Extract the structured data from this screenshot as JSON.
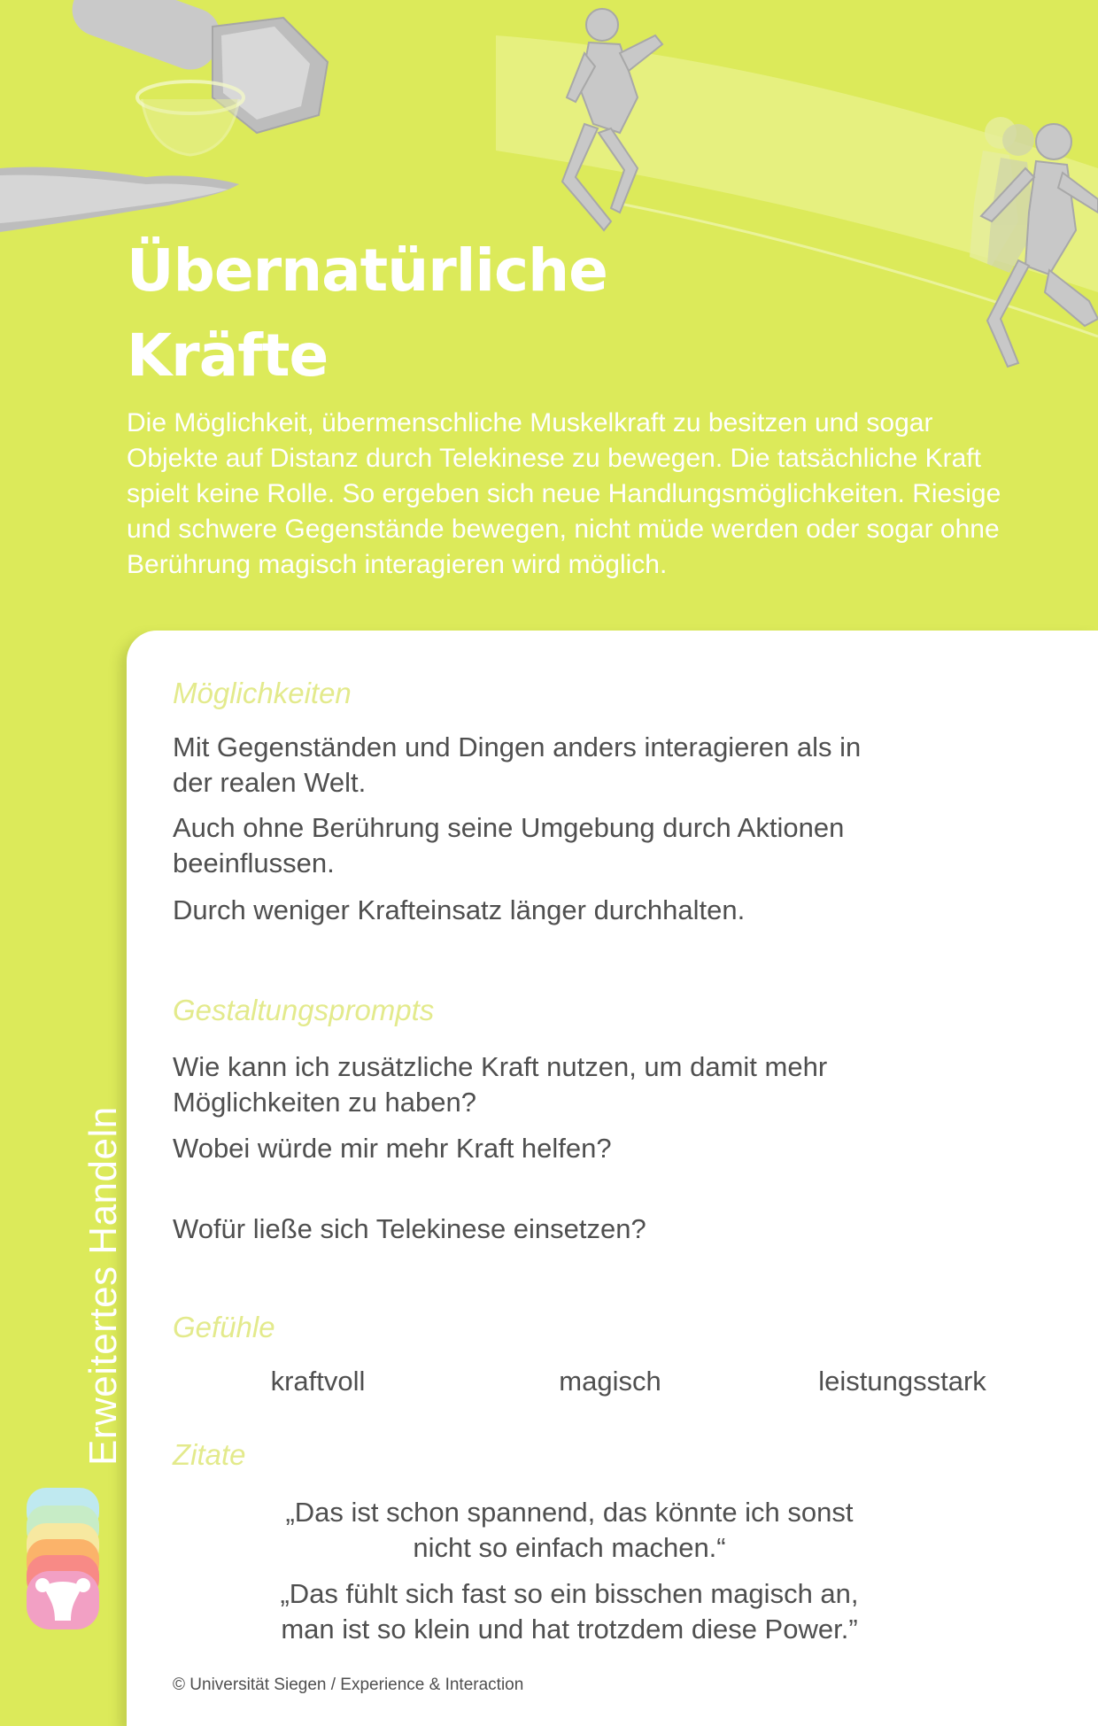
{
  "header": {
    "title_line1": "Übernatürliche",
    "title_line2": "Kräfte",
    "intro": "Die Möglichkeit, übermenschliche Muskelkraft zu besitzen und sogar Objekte auf Distanz durch Telekinese zu bewegen. Die tatsächliche Kraft spielt keine Rolle. So ergeben sich neue Handlungsmöglichkeiten. Riesige und schwere Gegenstände bewegen, nicht müde werden oder sogar ohne Berührung magisch interagieren wird möglich."
  },
  "sections": {
    "moeglichkeiten": {
      "title": "Möglichkeiten",
      "items": [
        "Mit Gegenständen und Dingen anders interagieren als in der realen Welt.",
        "Auch ohne Berührung seine Umgebung durch Aktionen beeinflussen.",
        "Durch weniger Krafteinsatz länger durchhalten."
      ]
    },
    "gestaltungsprompts": {
      "title": "Gestaltungsprompts",
      "items": [
        "Wie kann ich zusätzliche Kraft nutzen, um damit mehr Möglichkeiten zu haben?",
        "Wobei würde mir mehr Kraft helfen?",
        "Wofür ließe sich Telekinese einsetzen?"
      ]
    },
    "gefuehle": {
      "title": "Gefühle",
      "items": [
        "kraftvoll",
        "magisch",
        "leistungsstark"
      ]
    },
    "zitate": {
      "title": "Zitate",
      "items": [
        "„Das ist schon spannend, das könnte ich sonst nicht so einfach machen.“",
        "„Das fühlt sich fast so ein bisschen magisch an, man ist so klein und hat trotzdem diese Power.”"
      ]
    }
  },
  "footer": {
    "copyright": "© Universität Siegen / Experience & Interaction"
  },
  "side_label": "Erweitertes Handeln",
  "colors": {
    "background": "#dcea5a",
    "section_title": "#e3ea8c",
    "body_text": "#4f4f4f",
    "card": "#ffffff"
  },
  "icons": {
    "hero": "strength-illustration",
    "logo": "category-logo-icon"
  }
}
